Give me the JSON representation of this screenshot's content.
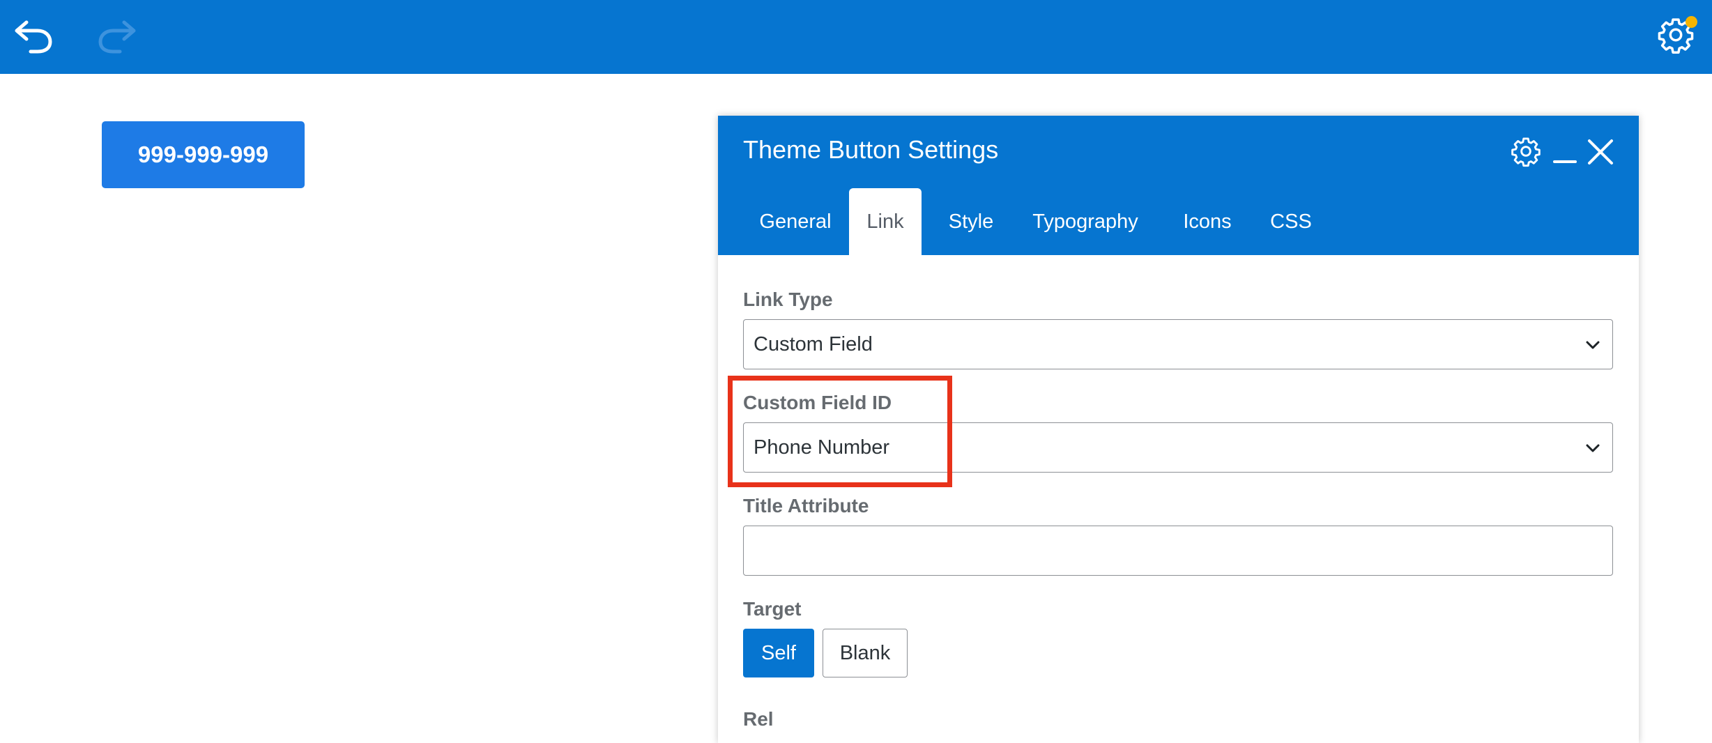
{
  "toolbar": {
    "undo_icon": "undo-icon",
    "redo_icon": "redo-icon",
    "settings_icon": "gear-icon",
    "notification_color": "#f5b400"
  },
  "preview": {
    "button_label": "999-999-999"
  },
  "panel": {
    "title": "Theme Button Settings",
    "tabs": [
      {
        "label": "General"
      },
      {
        "label": "Link",
        "active": true
      },
      {
        "label": "Style"
      },
      {
        "label": "Typography"
      },
      {
        "label": "Icons"
      },
      {
        "label": "CSS"
      }
    ],
    "link_type": {
      "label": "Link Type",
      "value": "Custom Field"
    },
    "custom_field_id": {
      "label": "Custom Field ID",
      "value": "Phone Number"
    },
    "title_attribute": {
      "label": "Title Attribute",
      "value": ""
    },
    "target": {
      "label": "Target",
      "options": [
        "Self",
        "Blank"
      ],
      "selected": "Self"
    },
    "rel": {
      "label": "Rel"
    }
  },
  "colors": {
    "accent": "#0675d0",
    "preview_button": "#1e7be6",
    "highlight": "#e8321a"
  }
}
